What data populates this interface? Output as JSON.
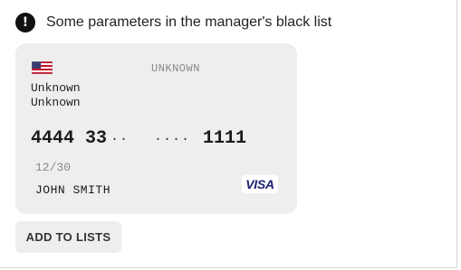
{
  "alert": {
    "icon": "exclamation-icon",
    "message": "Some parameters in the manager's black list"
  },
  "card": {
    "country_flag_icon": "us-flag-icon",
    "bank_name": "UNKNOWN",
    "card_type_line1": "Unknown",
    "card_type_line2": "Unknown",
    "number_prefix": "4444 33",
    "number_mask1": "··",
    "number_mask2": "····",
    "number_suffix": "1111",
    "expiry": "12/30",
    "holder_name": "JOHN SMITH",
    "brand": "VISA",
    "background_color": "#eeeeee",
    "brand_color": "#1a1f71"
  },
  "actions": {
    "add_to_lists_label": "ADD TO LISTS"
  }
}
